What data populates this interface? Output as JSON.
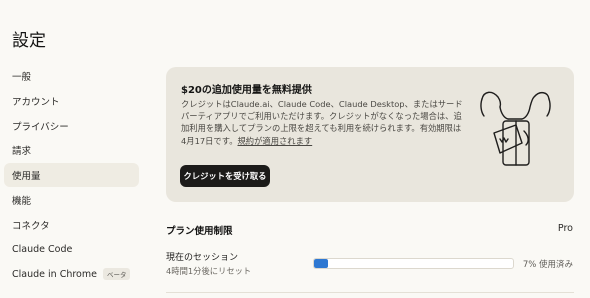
{
  "page": {
    "title": "設定"
  },
  "sidebar": {
    "items": [
      {
        "label": "一般"
      },
      {
        "label": "アカウント"
      },
      {
        "label": "プライバシー"
      },
      {
        "label": "請求"
      },
      {
        "label": "使用量",
        "active": true
      },
      {
        "label": "機能"
      },
      {
        "label": "コネクタ"
      },
      {
        "label": "Claude Code"
      },
      {
        "label": "Claude in Chrome",
        "badge": "ベータ"
      }
    ]
  },
  "promo": {
    "title": "$20の追加使用量を無料提供",
    "body": "クレジットはClaude.ai、Claude Code、Claude Desktop、またはサードパーティアプリでご利用いただけます。クレジットがなくなった場合は、追加利用を購入してプランの上限を超えても利用を続けられます。有効期限は4月17日です。",
    "link": "規約が適用されます",
    "button": "クレジットを受け取る",
    "illustration_icon": "gift-box-icon"
  },
  "usage": {
    "title": "プラン使用制限",
    "plan": "Pro",
    "session": {
      "label": "現在のセッション",
      "reset": "4時間1分後にリセット",
      "percent": 7,
      "percent_text": "7% 使用済み"
    }
  },
  "colors": {
    "background": "#faf9f5",
    "promo_bg": "#e9e6dd",
    "active_item_bg": "#efece3",
    "button_bg": "#1c1b19",
    "progress": "#2e78d2"
  }
}
